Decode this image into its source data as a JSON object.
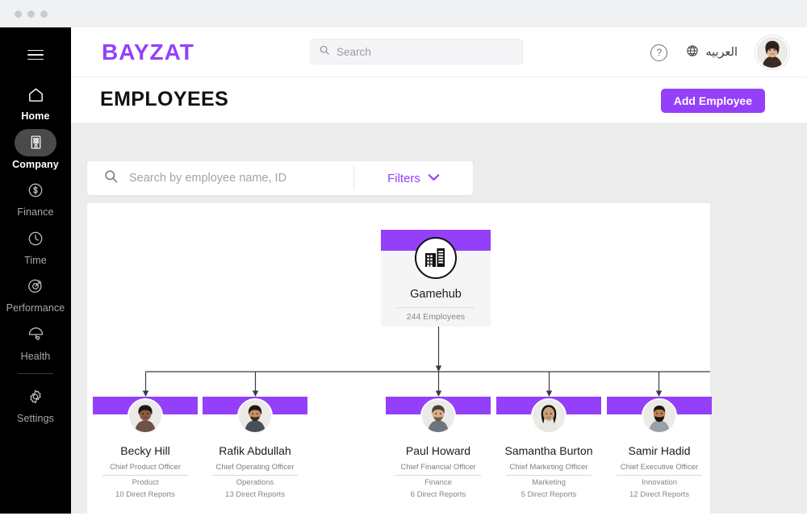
{
  "window": {
    "dots": [
      "close-dot",
      "minimize-dot",
      "maximize-dot"
    ]
  },
  "sidebar": {
    "menu_icon": "hamburger-icon",
    "items": [
      {
        "label": "Home",
        "icon": "home-icon",
        "active": false
      },
      {
        "label": "Company",
        "icon": "building-icon",
        "active": true
      },
      {
        "label": "Finance",
        "icon": "dollar-circle-icon",
        "active": false
      },
      {
        "label": "Time",
        "icon": "clock-icon",
        "active": false
      },
      {
        "label": "Performance",
        "icon": "target-icon",
        "active": false
      },
      {
        "label": "Health",
        "icon": "umbrella-heart-icon",
        "active": false
      },
      {
        "label": "Settings",
        "icon": "gear-icon",
        "active": false
      }
    ]
  },
  "header": {
    "logo": "BAYZAT",
    "search": {
      "placeholder": "Search",
      "value": "",
      "icon": "search-icon"
    },
    "help_icon": "question-circle-icon",
    "language": {
      "label": "العربيه",
      "icon": "globe-icon"
    },
    "avatar": "user-avatar"
  },
  "page": {
    "title": "EMPLOYEES",
    "add_button": "Add Employee"
  },
  "filters": {
    "search": {
      "placeholder": "Search by employee name, ID",
      "value": "",
      "icon": "search-icon"
    },
    "filters_label": "Filters",
    "chevron": "chevron-down-icon"
  },
  "colors": {
    "brand_purple": "#9440fa",
    "sidebar_bg": "#000000",
    "active_pill": "#4a4a4a",
    "page_bg": "#ececec",
    "card_body": "#f5f5f5"
  },
  "org_chart": {
    "root": {
      "name": "Gamehub",
      "meta": "244 Employees",
      "icon": "building-circle-icon"
    },
    "employees": [
      {
        "name": "Becky Hill",
        "title": "Chief Product Officer",
        "department": "Product",
        "reports": "10 Direct Reports",
        "avatar_skin": "#8a5a44",
        "avatar_hair": "#1e1611"
      },
      {
        "name": "Rafik Abdullah",
        "title": "Chief Operating Officer",
        "department": "Operations",
        "reports": "13 Direct Reports",
        "avatar_skin": "#c98f68",
        "avatar_hair": "#241a13"
      },
      {
        "name": "Paul Howard",
        "title": "Chief Financial Officer",
        "department": "Finance",
        "reports": "6 Direct Reports",
        "avatar_skin": "#d9ab86",
        "avatar_hair": "#4a4039"
      },
      {
        "name": "Samantha Burton",
        "title": "Chief Marketing Officer",
        "department": "Marketing",
        "reports": "5 Direct Reports",
        "avatar_skin": "#caa07e",
        "avatar_hair": "#181210"
      },
      {
        "name": "Samir Hadid",
        "title": "Chief Executive Officer",
        "department": "Innovation",
        "reports": "12 Direct Reports",
        "avatar_skin": "#b9805a",
        "avatar_hair": "#20160f"
      }
    ]
  }
}
